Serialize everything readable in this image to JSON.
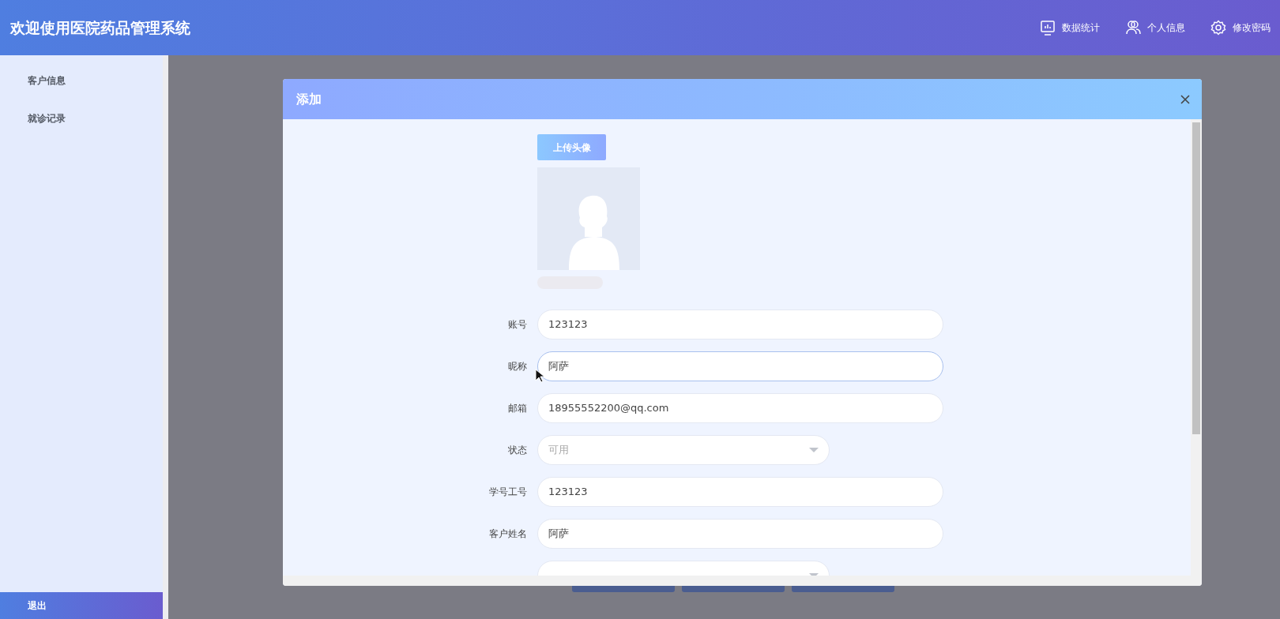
{
  "header": {
    "title": "欢迎使用医院药品管理系统",
    "actions": [
      {
        "label": "数据统计",
        "kind": "stats"
      },
      {
        "label": "个人信息",
        "kind": "user"
      },
      {
        "label": "修改密码",
        "kind": "settings"
      }
    ]
  },
  "sidebar": {
    "items": [
      {
        "label": "客户信息"
      },
      {
        "label": "就诊记录"
      }
    ],
    "logout": "退出"
  },
  "dialog": {
    "title": "添加",
    "upload_button": "上传头像",
    "fields": [
      {
        "kind": "input",
        "label": "账号",
        "value": "123123",
        "focused": false
      },
      {
        "kind": "input",
        "label": "昵称",
        "value": "阿萨",
        "focused": true
      },
      {
        "kind": "input",
        "label": "邮箱",
        "value": "18955552200@qq.com",
        "focused": false
      },
      {
        "kind": "select",
        "label": "状态",
        "placeholder": "可用"
      },
      {
        "kind": "input",
        "label": "学号工号",
        "value": "123123",
        "focused": false
      },
      {
        "kind": "input",
        "label": "客户姓名",
        "value": "阿萨",
        "focused": false
      },
      {
        "kind": "select"
      }
    ]
  }
}
